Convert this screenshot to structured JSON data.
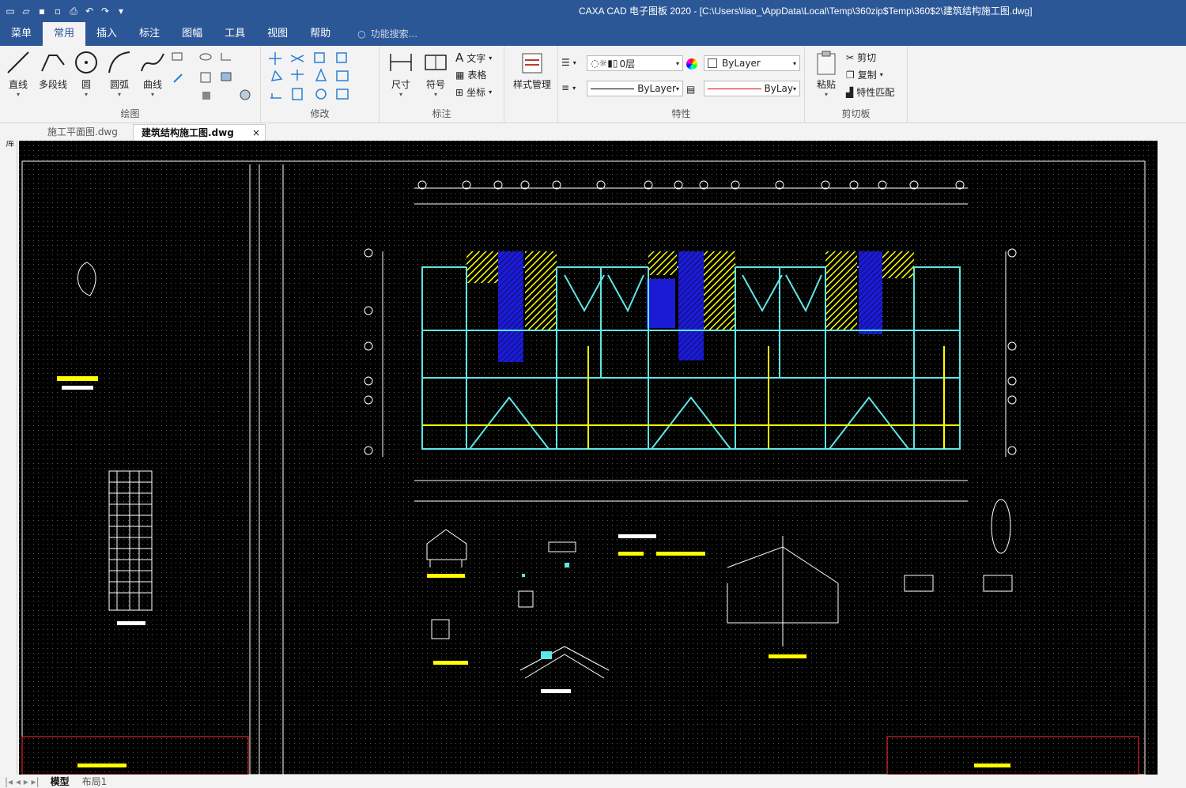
{
  "window": {
    "title": "CAXA CAD 电子图板 2020 - [C:\\Users\\liao_\\AppData\\Local\\Temp\\360zip$Temp\\360$2\\建筑结构施工图.dwg]"
  },
  "menu": {
    "tabs": [
      "菜单",
      "常用",
      "插入",
      "标注",
      "图幅",
      "工具",
      "视图",
      "帮助"
    ],
    "active": "常用",
    "search_label": "功能搜索..."
  },
  "ribbon": {
    "draw": {
      "label": "绘图",
      "buttons": [
        "直线",
        "多段线",
        "圆",
        "圆弧",
        "曲线"
      ]
    },
    "modify": {
      "label": "修改"
    },
    "annotate": {
      "label": "标注",
      "size": "尺寸",
      "symbol": "符号",
      "text": "文字",
      "table": "表格",
      "coord": "坐标"
    },
    "style": {
      "label": "样式管理"
    },
    "props": {
      "label": "特性",
      "layer": "0层",
      "color": "ByLayer",
      "linetype": "ByLayer",
      "lineweight": "ByLay"
    },
    "clipboard": {
      "label": "剪切板",
      "paste": "粘贴",
      "cut": "剪切",
      "copy": "复制",
      "match": "特性匹配"
    }
  },
  "doc_tabs": [
    "施工平面图.dwg",
    "建筑结构施工图.dwg"
  ],
  "active_doc": "建筑结构施工图.dwg",
  "left_strip": "图库",
  "bottom_tabs": [
    "模型",
    "布局1"
  ],
  "colors": {
    "canvas": "#000000",
    "grid": "#3a3f32",
    "cyan": "#5fe6e6",
    "yellow": "#ffff00",
    "blue": "#1b1bd6",
    "white": "#ffffff",
    "red": "#ff3030"
  }
}
